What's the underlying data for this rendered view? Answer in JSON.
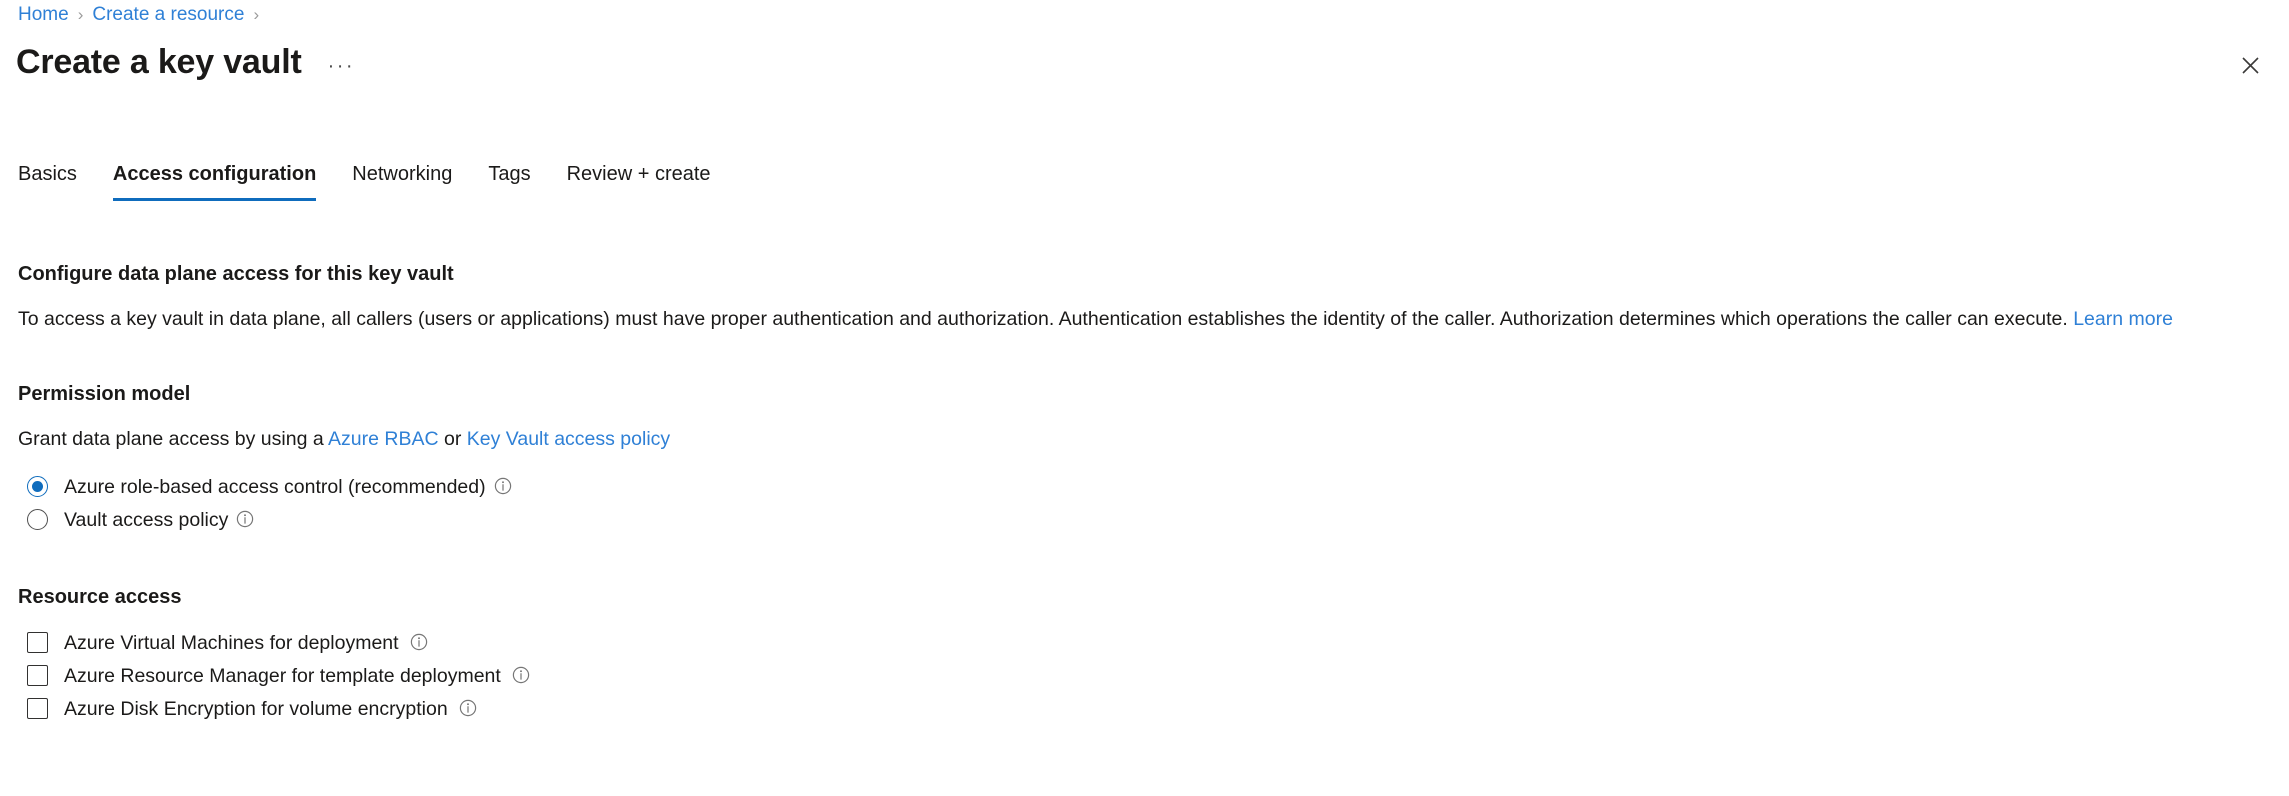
{
  "breadcrumb": {
    "items": [
      {
        "label": "Home",
        "type": "link"
      },
      {
        "label": "Create a resource",
        "type": "link"
      }
    ],
    "separator": "›"
  },
  "header": {
    "title": "Create a key vault",
    "more_actions_label": "···",
    "close_icon": "close-icon"
  },
  "tabs": [
    {
      "label": "Basics",
      "active": false
    },
    {
      "label": "Access configuration",
      "active": true
    },
    {
      "label": "Networking",
      "active": false
    },
    {
      "label": "Tags",
      "active": false
    },
    {
      "label": "Review + create",
      "active": false
    }
  ],
  "main": {
    "data_plane": {
      "heading": "Configure data plane access for this key vault",
      "description": "To access a key vault in data plane, all callers (users or applications) must have proper authentication and authorization. Authentication establishes the identity of the caller. Authorization determines which operations the caller can execute.",
      "learn_more_label": "Learn more"
    },
    "permission_model": {
      "heading": "Permission model",
      "description_prefix": "Grant data plane access by using a",
      "link_rbac": "Azure RBAC",
      "conjunction": "or",
      "link_access_policy": "Key Vault access policy",
      "options": [
        {
          "label": "Azure role-based access control (recommended)",
          "selected": true,
          "info_icon": "info-icon"
        },
        {
          "label": "Vault access policy",
          "selected": false,
          "info_icon": "info-icon"
        }
      ]
    },
    "resource_access": {
      "heading": "Resource access",
      "options": [
        {
          "label": "Azure Virtual Machines for deployment",
          "checked": false,
          "info_icon": "info-icon"
        },
        {
          "label": "Azure Resource Manager for template deployment",
          "checked": false,
          "info_icon": "info-icon"
        },
        {
          "label": "Azure Disk Encryption for volume encryption",
          "checked": false,
          "info_icon": "info-icon"
        }
      ]
    }
  },
  "colors": {
    "link": "#2f80d6",
    "accent": "#0f6cbd",
    "text": "#1b1a19",
    "border": "#323130",
    "separator": "#9b9b9b",
    "background": "#ffffff"
  }
}
